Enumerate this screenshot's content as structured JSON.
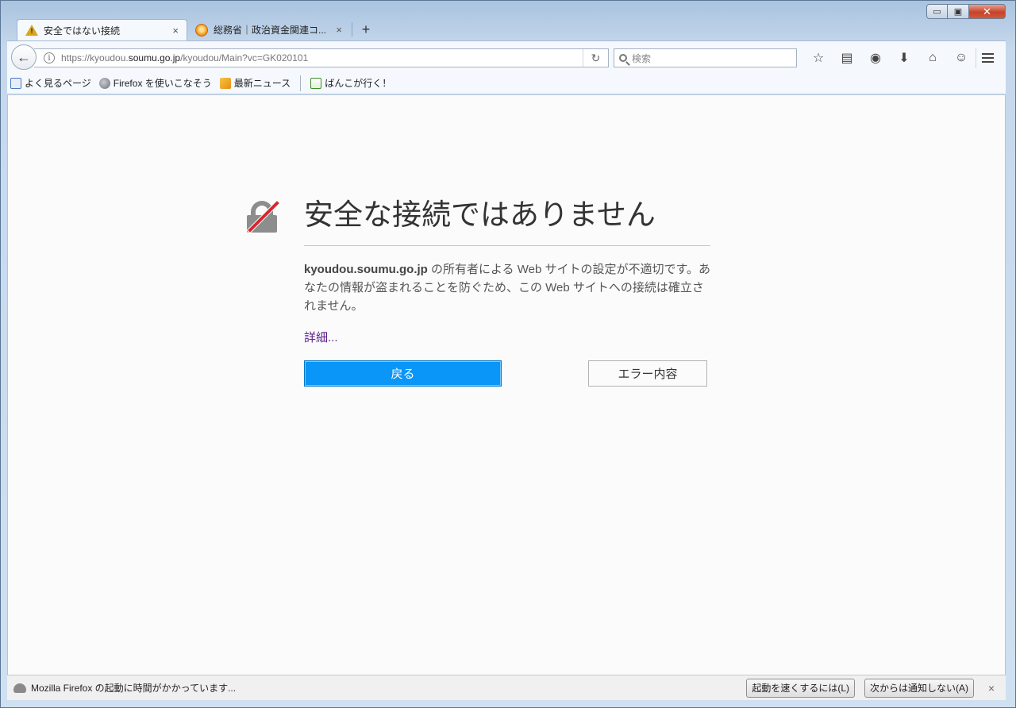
{
  "window": {
    "caption": {
      "minimize": "▭",
      "maximize": "▣",
      "close": "✕"
    }
  },
  "tabs": [
    {
      "title": "安全ではない接続",
      "close": "×",
      "icon": "warning-icon"
    },
    {
      "title": "総務省｜政治資金関連コ...",
      "close": "×",
      "icon": "soumu-favicon"
    }
  ],
  "new_tab_label": "+",
  "navbar": {
    "back_icon": "←",
    "info_icon": "i",
    "url": {
      "prefix": "https://kyoudou.",
      "domain": "soumu.go.jp",
      "path": "/kyoudou/Main?vc=GK020101"
    },
    "reload_icon": "↻",
    "search_placeholder": "検索",
    "toolbar_icons": [
      {
        "name": "bookmark-star-icon",
        "glyph": "☆"
      },
      {
        "name": "reading-list-icon",
        "glyph": "▤"
      },
      {
        "name": "pocket-icon",
        "glyph": "◉"
      },
      {
        "name": "downloads-icon",
        "glyph": "⬇"
      },
      {
        "name": "home-icon",
        "glyph": "⌂"
      },
      {
        "name": "hello-chat-icon",
        "glyph": "☺"
      }
    ]
  },
  "bookmarks": [
    {
      "label": "よく見るページ",
      "icon": "most-visited-icon"
    },
    {
      "label": "Firefox を使いこなそう",
      "icon": "globe-icon"
    },
    {
      "label": "最新ニュース",
      "icon": "rss-icon"
    },
    {
      "label": "ばんこが行く！",
      "icon": "banko-icon"
    }
  ],
  "error": {
    "title": "安全な接続ではありません",
    "desc_domain": "kyoudou.soumu.go.jp",
    "desc_rest": " の所有者による Web サイトの設定が不適切です。あなたの情報が盗まれることを防ぐため、この Web サイトへの接続は確立されません。",
    "more_link": "詳細...",
    "back_button": "戻る",
    "details_button": "エラー内容"
  },
  "notification": {
    "message": "Mozilla Firefox の起動に時間がかかっています...",
    "speedup_button": "起動を速くするには(L)",
    "dont_notify_button": "次からは通知しない(A)",
    "close": "×"
  }
}
